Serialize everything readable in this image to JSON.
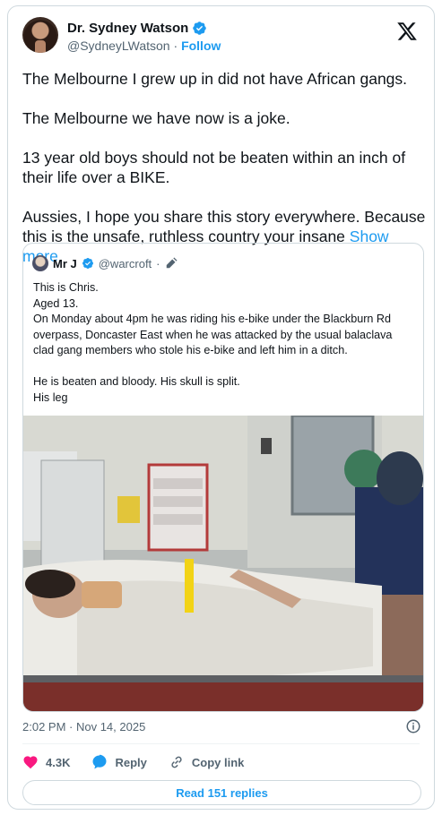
{
  "author": {
    "display_name": "Dr. Sydney Watson",
    "handle": "@SydneyLWatson",
    "separator": "·",
    "follow_label": "Follow",
    "avatar_icon": "profile-photo",
    "verified_icon": "verified-badge-icon"
  },
  "tweet": {
    "paragraphs": [
      "The Melbourne I grew up in did not have African gangs.",
      "The Melbourne we have now is a joke.",
      "13 year old boys should not be beaten within an inch of their life over a BIKE.",
      "Aussies, I hope you share this story everywhere. Because this is the unsafe, ruthless country your insane"
    ],
    "show_more": "Show more"
  },
  "quoted": {
    "display_name": "Mr J",
    "handle": "@warcroft",
    "separator": "·",
    "lines": [
      "This is Chris.",
      "Aged 13.",
      "On Monday about 4pm he was riding his e-bike under the Blackburn Rd",
      "overpass, Doncaster East when he was attacked by the usual balaclava",
      "clad gang members who stole his e-bike and left him in a ditch.",
      "",
      "He is beaten and bloody. His skull is split.",
      "His leg"
    ]
  },
  "meta": {
    "timestamp": "2:02 PM · Nov 14, 2025"
  },
  "actions": {
    "likes": "4.3K",
    "reply_label": "Reply",
    "copy_link_label": "Copy link"
  },
  "read_replies_label": "Read 151 replies",
  "colors": {
    "accent": "#1d9bf0",
    "like": "#f91880",
    "muted": "#536471",
    "border": "#cfd9de"
  }
}
